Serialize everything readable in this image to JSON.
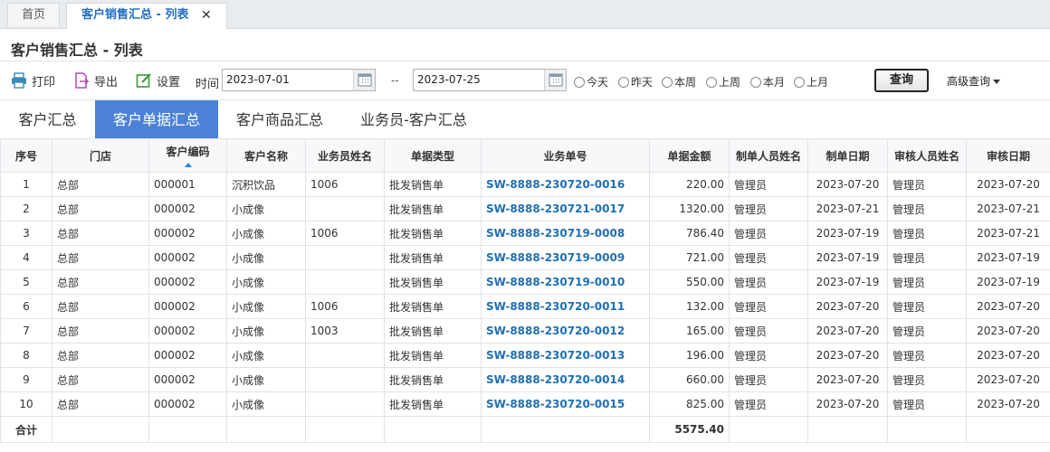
{
  "tabs": {
    "home": "首页",
    "active": "客户销售汇总 - 列表",
    "close": "✕"
  },
  "page_title": "客户销售汇总 - 列表",
  "toolbar": {
    "print": "打印",
    "export": "导出",
    "settings": "设置",
    "time_label": "时间",
    "date_from": "2023-07-01",
    "date_to": "2023-07-25",
    "dash": "--",
    "quick": [
      "今天",
      "昨天",
      "本周",
      "上周",
      "本月",
      "上月"
    ],
    "query": "查询",
    "advanced": "高级查询"
  },
  "subtabs": [
    "客户汇总",
    "客户单据汇总",
    "客户商品汇总",
    "业务员-客户汇总"
  ],
  "columns": [
    "序号",
    "门店",
    "客户编码",
    "客户名称",
    "业务员姓名",
    "单据类型",
    "业务单号",
    "单据金额",
    "制单人员姓名",
    "制单日期",
    "审核人员姓名",
    "审核日期"
  ],
  "rows": [
    [
      "1",
      "总部",
      "000001",
      "沉积饮品",
      "1006",
      "批发销售单",
      "SW-8888-230720-0016",
      "220.00",
      "管理员",
      "2023-07-20",
      "管理员",
      "2023-07-20"
    ],
    [
      "2",
      "总部",
      "000002",
      "小成像",
      "",
      "批发销售单",
      "SW-8888-230721-0017",
      "1320.00",
      "管理员",
      "2023-07-21",
      "管理员",
      "2023-07-21"
    ],
    [
      "3",
      "总部",
      "000002",
      "小成像",
      "1006",
      "批发销售单",
      "SW-8888-230719-0008",
      "786.40",
      "管理员",
      "2023-07-19",
      "管理员",
      "2023-07-21"
    ],
    [
      "4",
      "总部",
      "000002",
      "小成像",
      "",
      "批发销售单",
      "SW-8888-230719-0009",
      "721.00",
      "管理员",
      "2023-07-19",
      "管理员",
      "2023-07-19"
    ],
    [
      "5",
      "总部",
      "000002",
      "小成像",
      "",
      "批发销售单",
      "SW-8888-230719-0010",
      "550.00",
      "管理员",
      "2023-07-19",
      "管理员",
      "2023-07-19"
    ],
    [
      "6",
      "总部",
      "000002",
      "小成像",
      "1006",
      "批发销售单",
      "SW-8888-230720-0011",
      "132.00",
      "管理员",
      "2023-07-20",
      "管理员",
      "2023-07-20"
    ],
    [
      "7",
      "总部",
      "000002",
      "小成像",
      "1003",
      "批发销售单",
      "SW-8888-230720-0012",
      "165.00",
      "管理员",
      "2023-07-20",
      "管理员",
      "2023-07-20"
    ],
    [
      "8",
      "总部",
      "000002",
      "小成像",
      "",
      "批发销售单",
      "SW-8888-230720-0013",
      "196.00",
      "管理员",
      "2023-07-20",
      "管理员",
      "2023-07-20"
    ],
    [
      "9",
      "总部",
      "000002",
      "小成像",
      "",
      "批发销售单",
      "SW-8888-230720-0014",
      "660.00",
      "管理员",
      "2023-07-20",
      "管理员",
      "2023-07-20"
    ],
    [
      "10",
      "总部",
      "000002",
      "小成像",
      "",
      "批发销售单",
      "SW-8888-230720-0015",
      "825.00",
      "管理员",
      "2023-07-20",
      "管理员",
      "2023-07-20"
    ]
  ],
  "total": {
    "label": "合计",
    "amount": "5575.40"
  },
  "colors": {
    "accent": "#4c82d6",
    "link": "#1f6fb5",
    "active_tab_text": "#1f6fc5"
  },
  "icons": {
    "print": "printer-icon",
    "export": "export-icon",
    "settings": "edit-settings-icon",
    "calendar": "calendar-icon",
    "sort": "sort-asc-icon"
  }
}
